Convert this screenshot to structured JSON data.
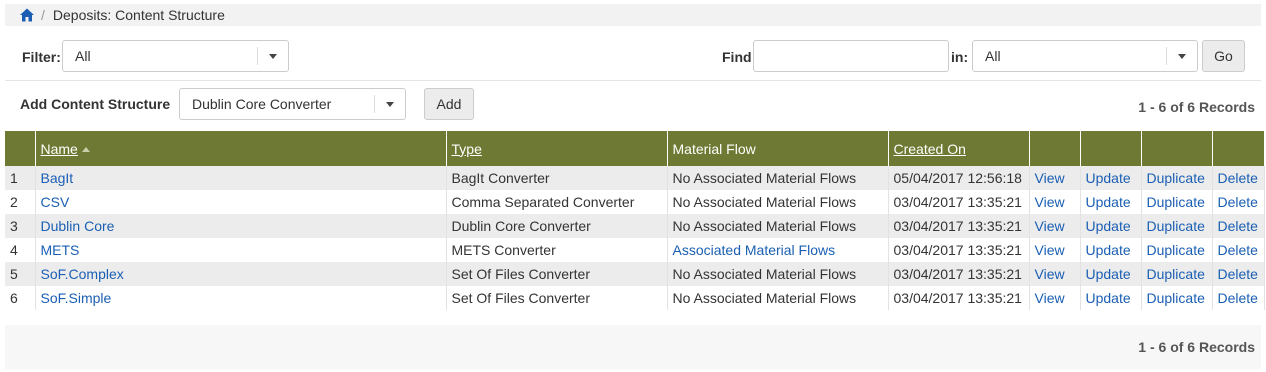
{
  "breadcrumb": {
    "home_icon": "home-icon",
    "separator": "/",
    "current": "Deposits: Content Structure"
  },
  "filter": {
    "label": "Filter:",
    "value": "All"
  },
  "find": {
    "label": "Find",
    "value": "",
    "in_label": "in:",
    "in_value": "All",
    "go_label": "Go"
  },
  "add": {
    "label": "Add Content Structure",
    "value": "Dublin Core Converter",
    "button_label": "Add"
  },
  "records_text": "1 - 6 of 6 Records",
  "table": {
    "headers": {
      "name": "Name",
      "type": "Type",
      "material_flow": "Material Flow",
      "created_on": "Created On"
    },
    "actions": {
      "view": "View",
      "update": "Update",
      "duplicate": "Duplicate",
      "delete": "Delete"
    },
    "rows": [
      {
        "num": "1",
        "name": "BagIt",
        "type": "BagIt Converter",
        "material_flow": "No Associated Material Flows",
        "created_on": "05/04/2017 12:56:18"
      },
      {
        "num": "2",
        "name": "CSV",
        "type": "Comma Separated Converter",
        "material_flow": "No Associated Material Flows",
        "created_on": "03/04/2017 13:35:21"
      },
      {
        "num": "3",
        "name": "Dublin Core",
        "type": "Dublin Core Converter",
        "material_flow": "No Associated Material Flows",
        "created_on": "03/04/2017 13:35:21"
      },
      {
        "num": "4",
        "name": "METS",
        "type": "METS Converter",
        "material_flow": "Associated Material Flows",
        "created_on": "03/04/2017 13:35:21"
      },
      {
        "num": "5",
        "name": "SoF.Complex",
        "type": "Set Of Files Converter",
        "material_flow": "No Associated Material Flows",
        "created_on": "03/04/2017 13:35:21"
      },
      {
        "num": "6",
        "name": "SoF.Simple",
        "type": "Set Of Files Converter",
        "material_flow": "No Associated Material Flows",
        "created_on": "03/04/2017 13:35:21"
      }
    ]
  },
  "colors": {
    "header_bg": "#6e7a33",
    "link": "#1a5fb4"
  }
}
